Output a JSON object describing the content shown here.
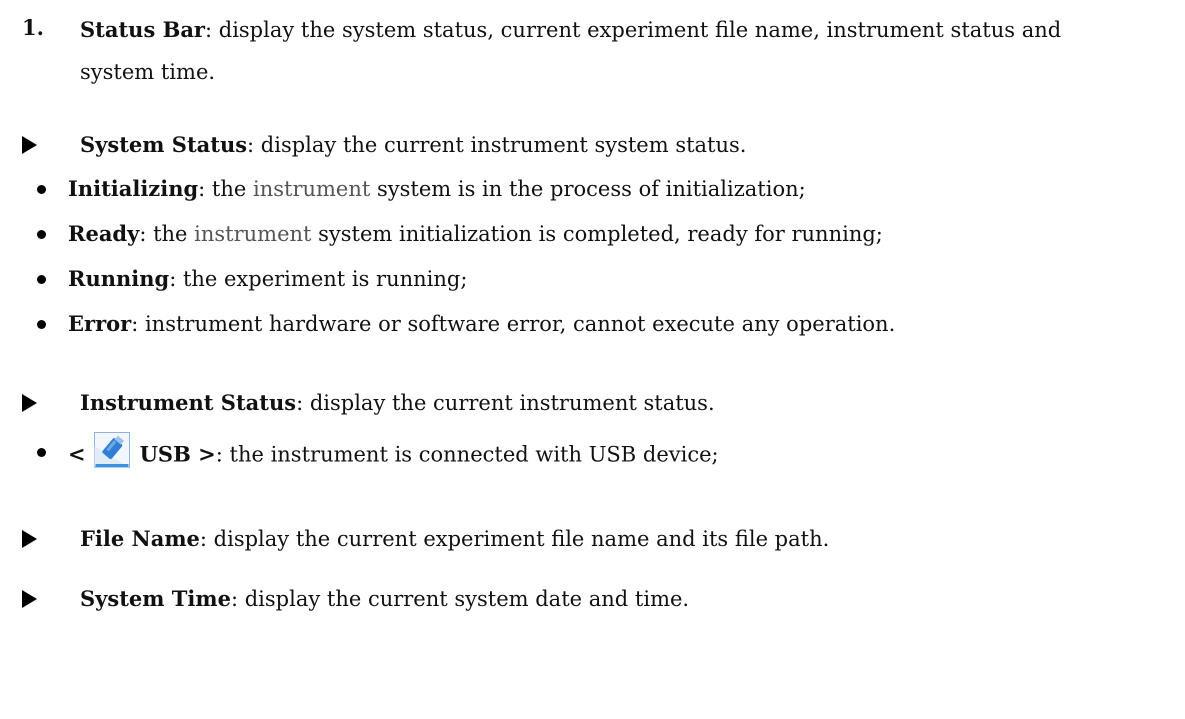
{
  "section1": {
    "number": "1.",
    "title": "Status Bar",
    "text_line1": ": display the system status, current experiment file name, instrument status and",
    "text_line2": "system time."
  },
  "system_status": {
    "title": "System Status",
    "text": ": display the current instrument system status.",
    "items": [
      {
        "term": "Initializing",
        "pre": ": the ",
        "soft": "instrument",
        "post": " system is in the process of initialization;"
      },
      {
        "term": "Ready",
        "pre": ": the ",
        "soft": "instrument",
        "post": " system initialization is completed, ready for running;"
      },
      {
        "term": "Running",
        "text": ": the experiment is running;"
      },
      {
        "term": "Error",
        "text": ": instrument hardware or software error, cannot execute any operation."
      }
    ]
  },
  "instrument_status": {
    "title": "Instrument Status",
    "text": ": display the current instrument status.",
    "usb_open": "<",
    "usb_label": "USB >",
    "usb_text": ": the instrument is connected with USB device;",
    "icon": "usb-drive-icon",
    "icon_color": "#2f7fd6"
  },
  "file_name": {
    "title": "File Name",
    "text": ": display the current experiment file name and its file path."
  },
  "system_time": {
    "title": "System Time",
    "text": ": display the current system date and time."
  }
}
